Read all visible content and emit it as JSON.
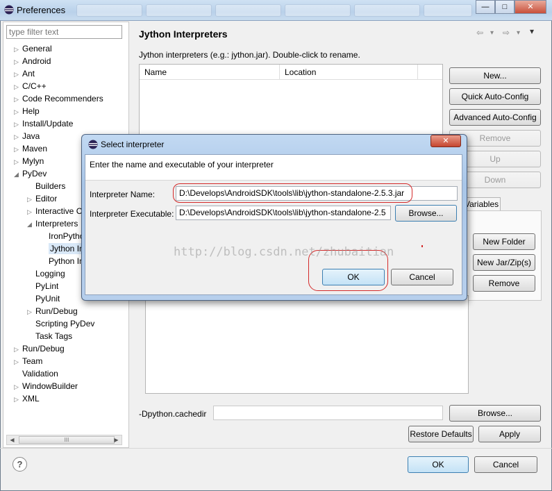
{
  "window": {
    "title": "Preferences",
    "controls": {
      "minimize": "—",
      "maximize": "□",
      "close": "✕"
    }
  },
  "tree": {
    "filter_placeholder": "type filter text",
    "items": [
      {
        "label": "General",
        "level": 0,
        "expander": "collapsed"
      },
      {
        "label": "Android",
        "level": 0,
        "expander": "collapsed"
      },
      {
        "label": "Ant",
        "level": 0,
        "expander": "collapsed"
      },
      {
        "label": "C/C++",
        "level": 0,
        "expander": "collapsed"
      },
      {
        "label": "Code Recommenders",
        "level": 0,
        "expander": "collapsed"
      },
      {
        "label": "Help",
        "level": 0,
        "expander": "collapsed"
      },
      {
        "label": "Install/Update",
        "level": 0,
        "expander": "collapsed"
      },
      {
        "label": "Java",
        "level": 0,
        "expander": "collapsed"
      },
      {
        "label": "Maven",
        "level": 0,
        "expander": "collapsed"
      },
      {
        "label": "Mylyn",
        "level": 0,
        "expander": "collapsed"
      },
      {
        "label": "PyDev",
        "level": 0,
        "expander": "expanded"
      },
      {
        "label": "Builders",
        "level": 1,
        "expander": "none"
      },
      {
        "label": "Editor",
        "level": 1,
        "expander": "collapsed"
      },
      {
        "label": "Interactive Co",
        "level": 1,
        "expander": "collapsed"
      },
      {
        "label": "Interpreters",
        "level": 1,
        "expander": "expanded"
      },
      {
        "label": "IronPython",
        "level": 2,
        "expander": "none"
      },
      {
        "label": "Jython Int",
        "level": 2,
        "expander": "none",
        "selected": true
      },
      {
        "label": "Python In",
        "level": 2,
        "expander": "none"
      },
      {
        "label": "Logging",
        "level": 1,
        "expander": "none"
      },
      {
        "label": "PyLint",
        "level": 1,
        "expander": "none"
      },
      {
        "label": "PyUnit",
        "level": 1,
        "expander": "none"
      },
      {
        "label": "Run/Debug",
        "level": 1,
        "expander": "collapsed"
      },
      {
        "label": "Scripting PyDev",
        "level": 1,
        "expander": "none"
      },
      {
        "label": "Task Tags",
        "level": 1,
        "expander": "none"
      },
      {
        "label": "Run/Debug",
        "level": 0,
        "expander": "collapsed"
      },
      {
        "label": "Team",
        "level": 0,
        "expander": "collapsed"
      },
      {
        "label": "Validation",
        "level": 0,
        "expander": "none"
      },
      {
        "label": "WindowBuilder",
        "level": 0,
        "expander": "collapsed"
      },
      {
        "label": "XML",
        "level": 0,
        "expander": "collapsed"
      }
    ],
    "scroll_thumb_grip": "III"
  },
  "page": {
    "title": "Jython Interpreters",
    "description": "Jython interpreters (e.g.: jython.jar).   Double-click to rename.",
    "table_headers": [
      "Name",
      "Location"
    ],
    "nav": {
      "back": "⇦",
      "forward": "⇨",
      "dropdown": "▾"
    }
  },
  "right_buttons": [
    {
      "label": "New...",
      "enabled": true
    },
    {
      "label": "Quick Auto-Config",
      "enabled": true
    },
    {
      "label": "Advanced Auto-Config",
      "enabled": true
    },
    {
      "label": "Remove",
      "enabled": false
    },
    {
      "label": "Up",
      "enabled": false
    },
    {
      "label": "Down",
      "enabled": false
    }
  ],
  "tab_partial": "Variables",
  "path_buttons": [
    "New Folder",
    "New Jar/Zip(s)",
    "Remove"
  ],
  "cachedir": {
    "label": "-Dpython.cachedir",
    "value": "",
    "browse": "Browse..."
  },
  "footer": {
    "restore_defaults": "Restore Defaults",
    "apply": "Apply",
    "ok": "OK",
    "cancel": "Cancel",
    "help": "?"
  },
  "dialog": {
    "title": "Select interpreter",
    "close": "✕",
    "description": "Enter the name and executable of your interpreter",
    "name_label": "Interpreter Name:",
    "name_value": "D:\\Develops\\AndroidSDK\\tools\\lib\\jython-standalone-2.5.3.jar",
    "exe_label": "Interpreter Executable:",
    "exe_value": "D:\\Develops\\AndroidSDK\\tools\\lib\\jython-standalone-2.5",
    "browse": "Browse...",
    "ok": "OK",
    "cancel": "Cancel"
  },
  "watermark": "http://blog.csdn.net/zhubaitian",
  "colors": {
    "title_gradient_top": "#cfe1f3",
    "dialog_frame": "#b7cfec",
    "annotation_red": "#d42a2a",
    "default_button": "#c4e2f6"
  }
}
